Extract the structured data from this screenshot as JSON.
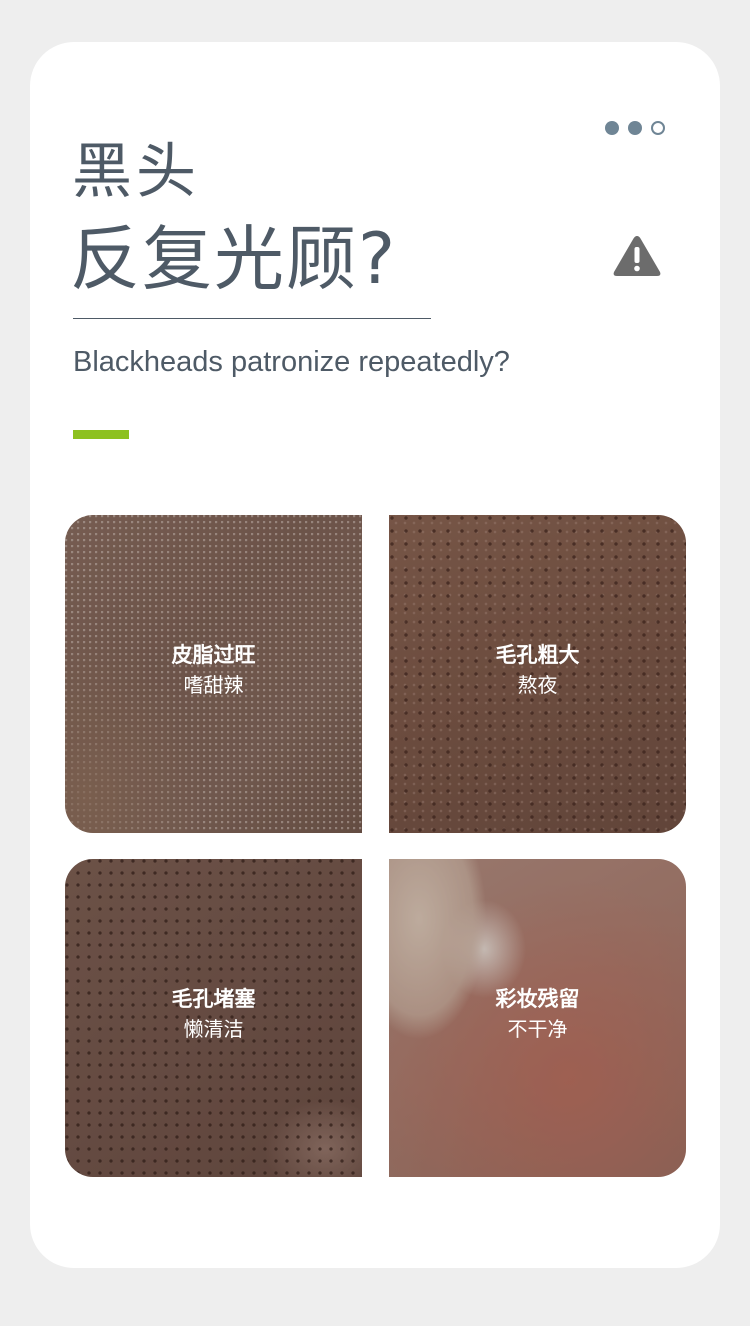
{
  "header": {
    "title_line1": "黑头",
    "title_line2": "反复光顾?",
    "subtitle": "Blackheads patronize repeatedly?",
    "pager": {
      "total": 3,
      "active": 2
    },
    "warning_icon": "warning-triangle-icon",
    "accent_color": "#8dc11f",
    "text_color": "#4e5a66"
  },
  "tiles": [
    {
      "title": "皮脂过旺",
      "caption": "嗜甜辣"
    },
    {
      "title": "毛孔粗大",
      "caption": "熬夜"
    },
    {
      "title": "毛孔堵塞",
      "caption": "懒清洁"
    },
    {
      "title": "彩妆残留",
      "caption": "不干净"
    }
  ]
}
